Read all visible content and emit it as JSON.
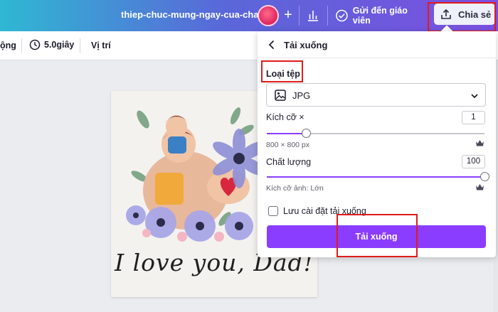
{
  "topbar": {
    "doc_title": "thiep-chuc-mung-ngay-cua-cha",
    "plus_label": "+",
    "send_label": "Gửi đến giáo viên",
    "share_label": "Chia sẻ"
  },
  "toolbar": {
    "partial_label": "ộng",
    "duration_label": "5.0giây",
    "position_label": "Vị trí"
  },
  "canvas": {
    "card_text": "I love you, Dad!"
  },
  "download_panel": {
    "title": "Tải xuống",
    "file_type_label": "Loại tệp",
    "file_type_value": "JPG",
    "size_label": "Kích cỡ ×",
    "size_value": "1",
    "size_fraction": 0.18,
    "size_hint": "800 × 800 px",
    "quality_label": "Chất lượng",
    "quality_value": "100",
    "quality_fraction": 1.0,
    "quality_hint": "Kích cỡ ảnh: Lớn",
    "save_settings_label": "Lưu cài đặt tải xuống",
    "save_settings_checked": false,
    "download_button": "Tải xuống"
  },
  "colors": {
    "accent": "#8b3dff",
    "highlight": "#e21b1b"
  },
  "icons": [
    "user-avatar-icon",
    "plus-icon",
    "bar-chart-icon",
    "check-circle-icon",
    "share-upload-icon",
    "clock-icon",
    "back-chevron-icon",
    "image-icon",
    "chevron-down-icon",
    "crown-icon"
  ]
}
